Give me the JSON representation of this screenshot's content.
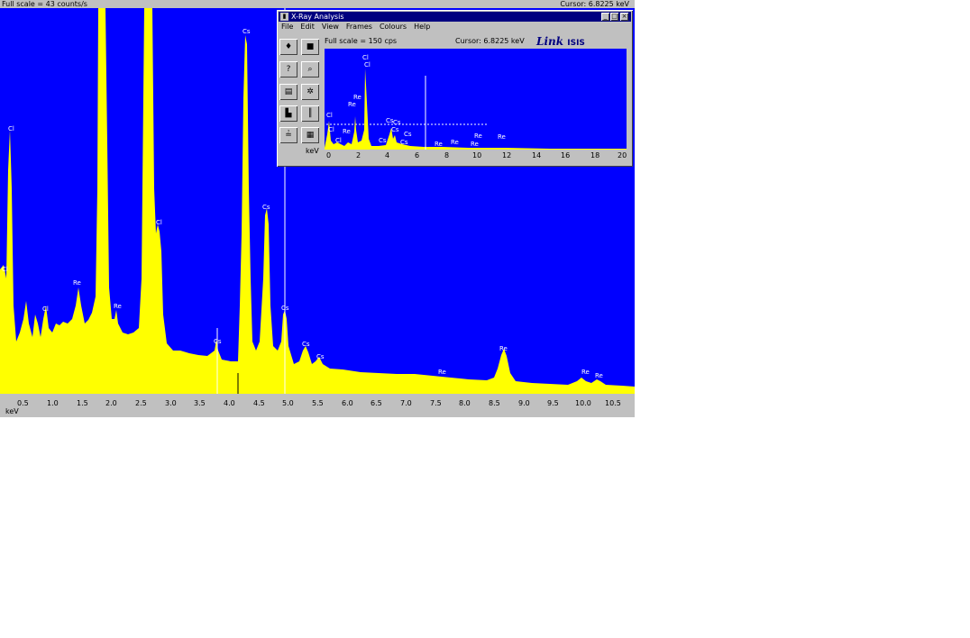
{
  "header": {
    "full_scale": "Full scale = 43  counts/s",
    "cursor": "Cursor: 6.8225 keV"
  },
  "main_axis": {
    "unit": "keV",
    "ticks": [
      "0.5",
      "1.0",
      "1.5",
      "2.0",
      "2.5",
      "3.0",
      "3.5",
      "4.0",
      "4.5",
      "5.0",
      "5.5",
      "6.0",
      "6.5",
      "7.0",
      "7.5",
      "8.0",
      "8.5",
      "9.0",
      "9.5",
      "10.0",
      "10.5"
    ]
  },
  "main_peak_labels": [
    "Cl",
    "Cl",
    "Re",
    "Cl",
    "Re",
    "Cl",
    "Cs",
    "Cs",
    "Cs",
    "Cs",
    "Cs",
    "Cs",
    "Re",
    "Re",
    "Re",
    "Re"
  ],
  "inset_window": {
    "title": "X-Ray Analysis",
    "menu": [
      "File",
      "Edit",
      "View",
      "Frames",
      "Colours",
      "Help"
    ],
    "full_scale": "Full scale = 150  cps",
    "cursor": "Cursor: 6.8225 keV",
    "logo": "Link",
    "logo_suffix": "ISIS",
    "axis_unit": "keV",
    "axis_ticks": [
      "0",
      "2",
      "4",
      "6",
      "8",
      "10",
      "12",
      "14",
      "16",
      "18",
      "20"
    ],
    "peak_labels": [
      "Cl",
      "Cl",
      "Cl",
      "Re",
      "Re",
      "Re",
      "Cl",
      "Cl",
      "Cs",
      "Cs",
      "Cs",
      "Cs",
      "Cs",
      "Cs",
      "Re",
      "Re",
      "Re",
      "Re",
      "Re"
    ],
    "window_buttons": [
      "_",
      "□",
      "×"
    ]
  },
  "colors": {
    "plot_bg": "#0000ff",
    "spectrum": "#ffff00",
    "title_bar": "#000080",
    "chrome": "#c0c0c0"
  }
}
